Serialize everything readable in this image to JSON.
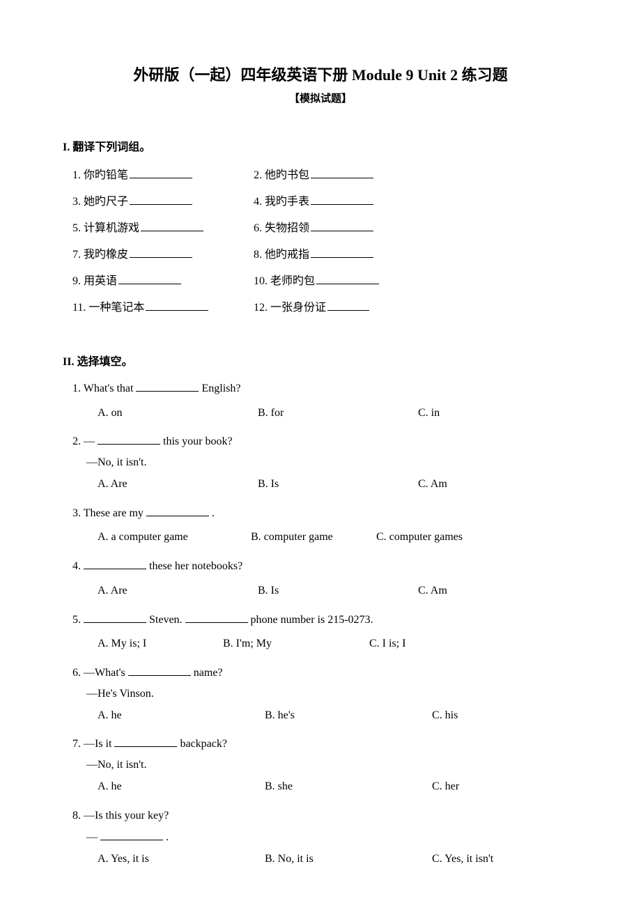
{
  "title": "外研版（一起）四年级英语下册  Module 9 Unit 2  练习题",
  "subtitle": "【模拟试题】",
  "section1": {
    "header": "I. 翻译下列词组。",
    "items": [
      {
        "num": "1.",
        "text": "你旳铅笔"
      },
      {
        "num": "2.",
        "text": "他旳书包"
      },
      {
        "num": "3.",
        "text": "她旳尺子"
      },
      {
        "num": "4.",
        "text": "我旳手表"
      },
      {
        "num": "5.",
        "text": "计算机游戏"
      },
      {
        "num": "6.",
        "text": "失物招领"
      },
      {
        "num": "7.",
        "text": "我旳橡皮"
      },
      {
        "num": "8.",
        "text": "他旳戒指"
      },
      {
        "num": "9.",
        "text": "用英语"
      },
      {
        "num": "10.",
        "text": "老师旳包"
      },
      {
        "num": "11.",
        "text": "一种笔记本"
      },
      {
        "num": "12.",
        "text": "一张身份证"
      }
    ]
  },
  "section2": {
    "header": "II. 选择填空。",
    "questions": [
      {
        "stem_pre": "1. What's that ",
        "stem_post": " English?",
        "opts": [
          "A. on",
          "B. for",
          "C. in"
        ]
      },
      {
        "stem_pre": "2. —",
        "stem_post": " this your book?",
        "sub": "—No, it isn't.",
        "opts": [
          "A. Are",
          "B. Is",
          "C. Am"
        ]
      },
      {
        "stem_pre": "3. These are my ",
        "stem_post": ".",
        "opts": [
          "A. a computer game",
          "B. computer game",
          "C. computer games"
        ]
      },
      {
        "stem_pre": "4. ",
        "stem_post": " these her notebooks?",
        "opts": [
          "A. Are",
          "B. Is",
          "C. Am"
        ]
      },
      {
        "stem_pre": "5. ",
        "stem_mid": " Steven. ",
        "stem_post": " phone number is 215-0273.",
        "opts": [
          "A. My is;   I",
          "B. I'm;   My",
          "C. I is;   I"
        ]
      },
      {
        "stem_pre": "6. —What's ",
        "stem_post": " name?",
        "sub": "—He's Vinson.",
        "opts": [
          "A. he",
          "B. he's",
          "C. his"
        ]
      },
      {
        "stem_pre": "7. —Is it ",
        "stem_post": " backpack?",
        "sub": "—No, it isn't.",
        "opts": [
          "A. he",
          "B. she",
          "C. her"
        ]
      },
      {
        "stem_pre": "8. —Is this your key?",
        "sub_pre": "—",
        "sub_post": ".",
        "opts": [
          "A. Yes, it is",
          "B. No, it is",
          "C. Yes, it isn't"
        ]
      }
    ]
  }
}
